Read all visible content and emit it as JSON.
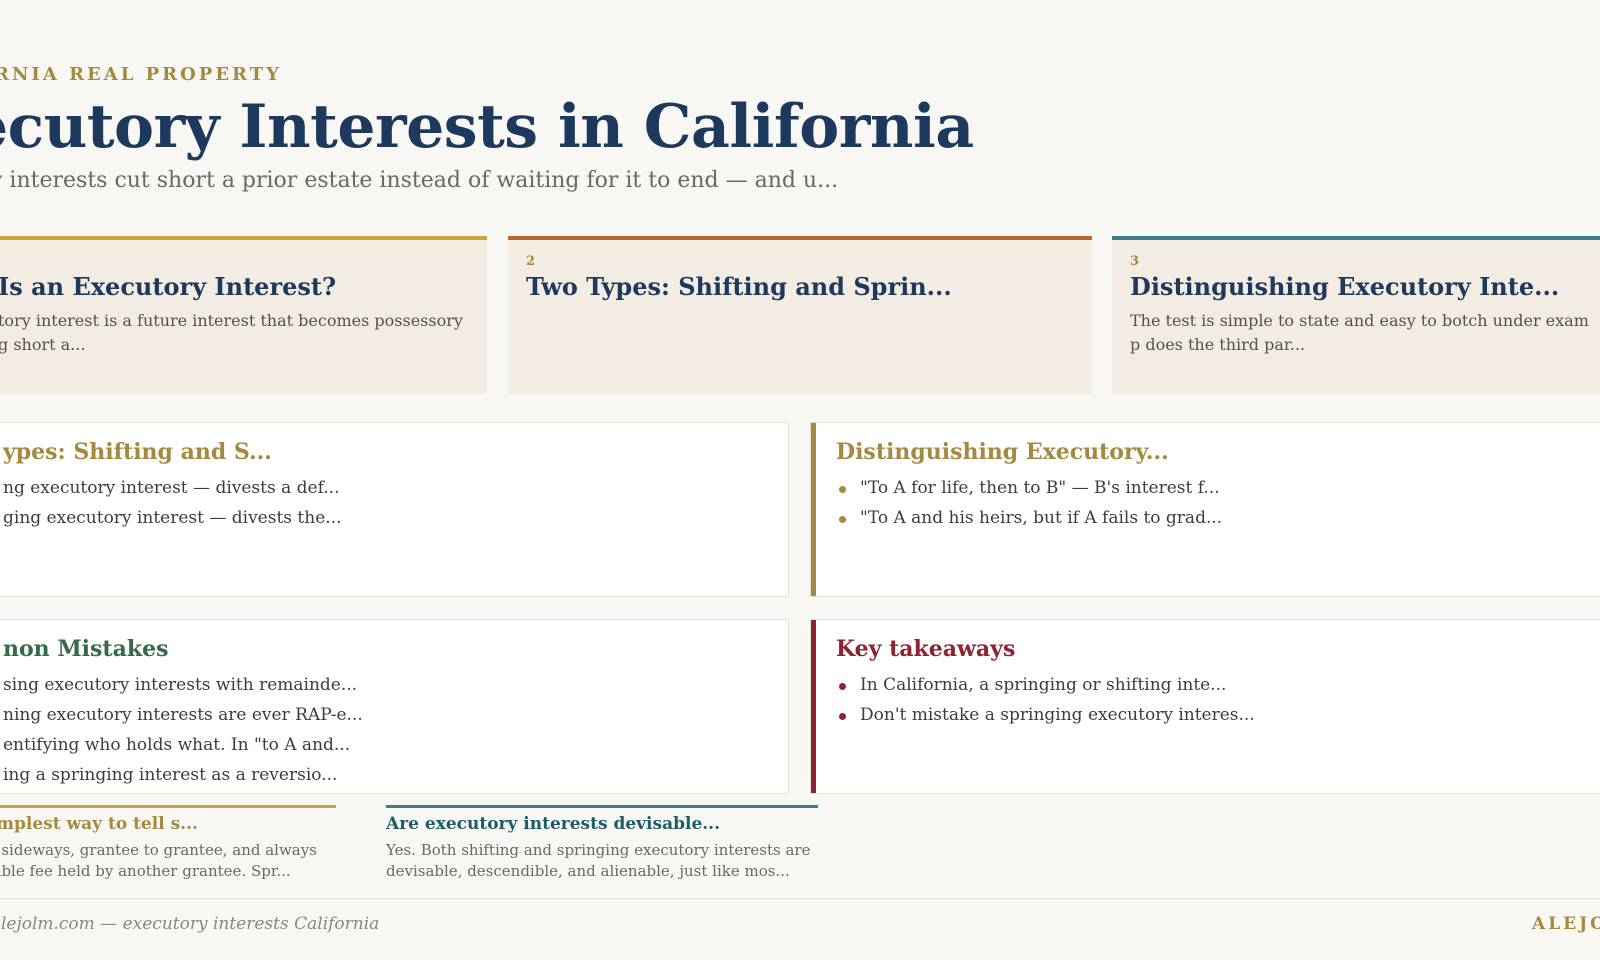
{
  "header": {
    "eyebrow": "RNIA REAL PROPERTY",
    "title": "ecutory Interests in California",
    "subtitle": "y interests cut short a prior estate instead of waiting for it to end — and u..."
  },
  "sections": [
    {
      "num": "",
      "title": "Is an Executory Interest?",
      "text": "tory interest is a future interest that becomes possessory g short a..."
    },
    {
      "num": "2",
      "title": "Two Types: Shifting and Sprin...",
      "text": ""
    },
    {
      "num": "3",
      "title": "Distinguishing Executory Inte...",
      "text": "The test is simple to state and easy to botch under exam p does the third par..."
    }
  ],
  "panels": {
    "types": {
      "title": "ypes: Shifting and S...",
      "items": [
        "ng executory interest — divests a def...",
        "ging executory interest — divests the..."
      ]
    },
    "distinguishing": {
      "title": "Distinguishing Executory...",
      "items": [
        "\"To A for life, then to B\" — B's interest f...",
        "\"To A and his heirs, but if A fails to grad..."
      ]
    },
    "mistakes": {
      "title": "non Mistakes",
      "items": [
        "sing executory interests with remainde...",
        "ning executory interests are ever RAP-e...",
        "entifying who holds what. In \"to A and...",
        "ing a springing interest as a reversio..."
      ]
    },
    "takeaways": {
      "title": "Key takeaways",
      "items": [
        "In California, a springing or shifting inte...",
        "Don't mistake a springing executory interes..."
      ]
    }
  },
  "faq": [
    {
      "q": "simplest way to tell s...",
      "a": "es sideways, grantee to grantee, and always asible fee held by another grantee. Spr..."
    },
    {
      "q": "Are executory interests devisable...",
      "a": "Yes. Both shifting and springing executory interests are devisable, descendible, and alienable, just like mos..."
    }
  ],
  "footer": {
    "left": "· alejolm.com — executory interests California",
    "right": "ALEJO"
  },
  "colors": {
    "navy": "#1d3a5e",
    "gold": "#a4893f",
    "rust": "#b8642a",
    "teal": "#3b7c86",
    "green": "#356a4b",
    "crimson": "#8f2230"
  }
}
